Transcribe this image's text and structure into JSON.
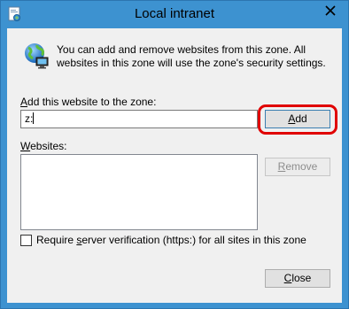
{
  "window": {
    "title": "Local intranet"
  },
  "description": "You can add and remove websites from this zone. All websites in this zone will use the zone's security settings.",
  "add_field": {
    "label_prefix": "",
    "label_accel": "A",
    "label_rest": "dd this website to the zone:",
    "value": "z:"
  },
  "add_button": {
    "accel": "A",
    "rest": "dd"
  },
  "websites": {
    "label_accel": "W",
    "label_rest": "ebsites:",
    "items": []
  },
  "remove_button": {
    "accel": "R",
    "rest": "emove"
  },
  "checkbox": {
    "prefix": "Require ",
    "accel": "s",
    "rest": "erver verification (https:) for all sites in this zone",
    "checked": false
  },
  "close_button": {
    "accel": "C",
    "rest": "lose"
  },
  "colors": {
    "frame": "#3d92d0",
    "client": "#f0f0f0",
    "highlight": "#e00000"
  },
  "icons": {
    "title": "security-zone-icon",
    "globe": "intranet-globe-icon",
    "close": "close-icon"
  }
}
